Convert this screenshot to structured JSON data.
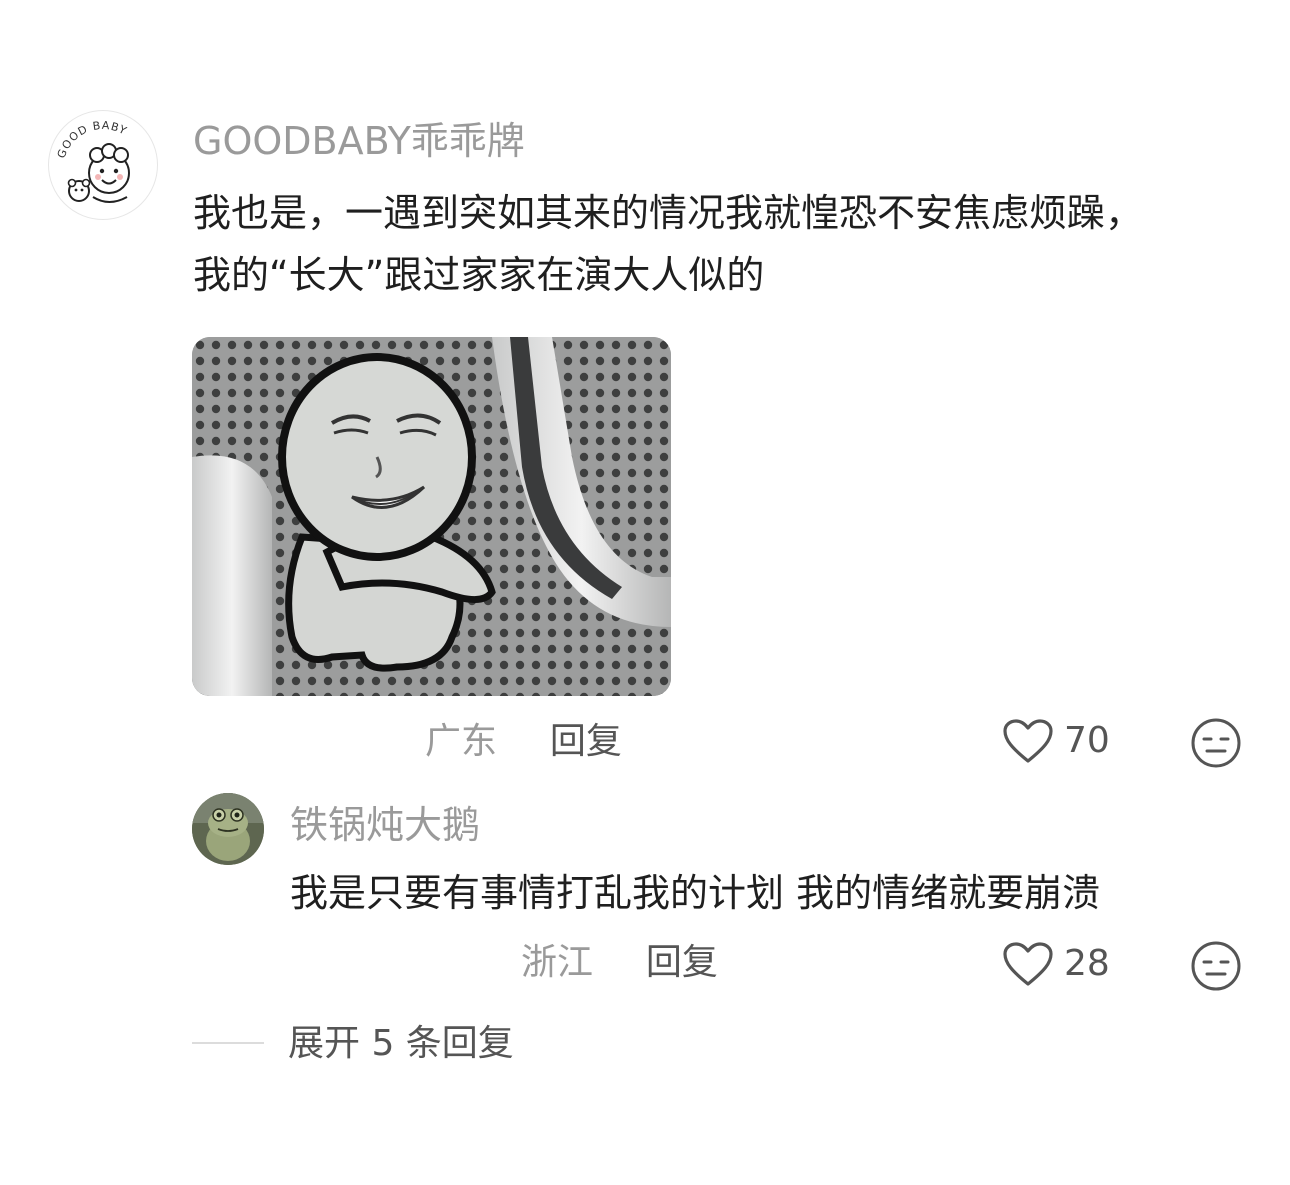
{
  "comment": {
    "username": "GOODBABY乖乖牌",
    "avatar_text": "GOOD BABY",
    "text_lines": [
      "我也是，一遇到突如其来的情况我就惶恐不安焦虑烦躁，",
      "我的“长大”跟过家家在演大人似的"
    ],
    "location": "广东",
    "reply_label": "回复",
    "likes": "70"
  },
  "reply": {
    "username": "铁锅炖大鹅",
    "text": "我是只要有事情打乱我的计划 我的情绪就要崩溃",
    "location": "浙江",
    "reply_label": "回复",
    "likes": "28"
  },
  "expand": {
    "label": "展开 5 条回复"
  },
  "icons": {
    "like": "heart-outline-icon",
    "reaction": "meh-face-icon"
  },
  "colors": {
    "secondary_text": "#9a9a9a",
    "primary_text": "#1f1f1f",
    "action_text": "#555555"
  }
}
